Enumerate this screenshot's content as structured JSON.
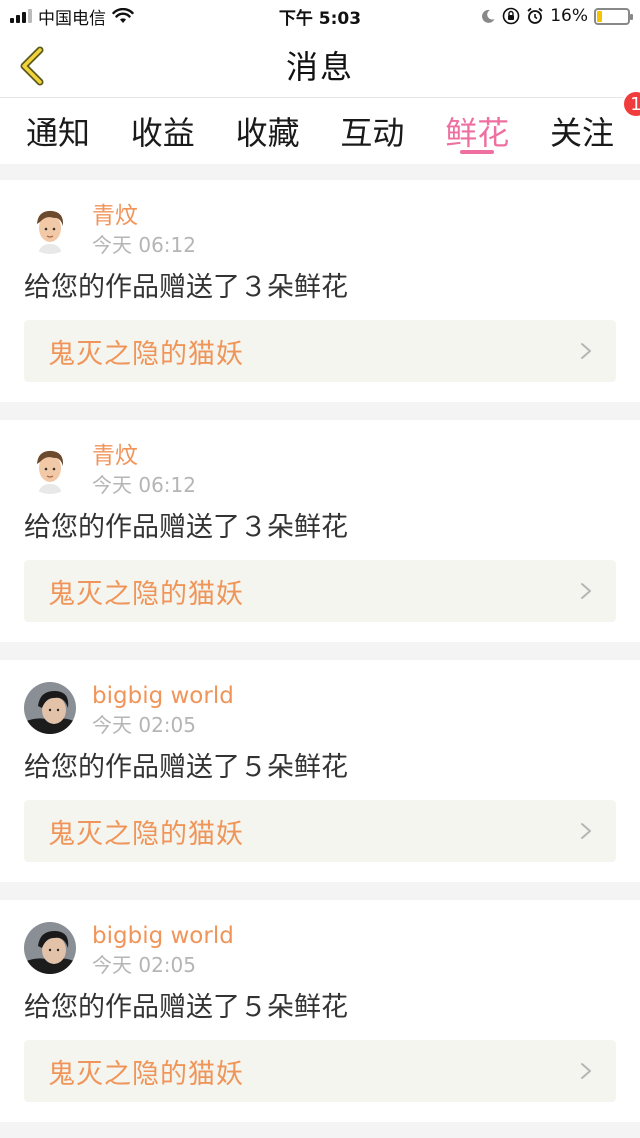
{
  "status_bar": {
    "carrier": "中国电信",
    "time": "下午 5:03",
    "battery_percent": "16%",
    "battery_level": 0.16
  },
  "nav": {
    "title": "消息"
  },
  "tabs": [
    {
      "label": "通知",
      "active": false
    },
    {
      "label": "收益",
      "active": false
    },
    {
      "label": "收藏",
      "active": false
    },
    {
      "label": "互动",
      "active": false
    },
    {
      "label": "鲜花",
      "active": true
    },
    {
      "label": "关注",
      "active": false,
      "badge": "1"
    }
  ],
  "colors": {
    "accent": "#ee6fa0",
    "username": "#f0955a",
    "badge": "#f03c3c"
  },
  "messages": [
    {
      "username": "青炆",
      "time": "今天 06:12",
      "text": "给您的作品赠送了３朵鲜花",
      "work": "鬼灭之隐的猫妖",
      "avatar": "avatar-cartoon-icon"
    },
    {
      "username": "青炆",
      "time": "今天 06:12",
      "text": "给您的作品赠送了３朵鲜花",
      "work": "鬼灭之隐的猫妖",
      "avatar": "avatar-cartoon-icon"
    },
    {
      "username": "bigbig world",
      "time": "今天 02:05",
      "text": "给您的作品赠送了５朵鲜花",
      "work": "鬼灭之隐的猫妖",
      "avatar": "avatar-photo-icon"
    },
    {
      "username": "bigbig world",
      "time": "今天 02:05",
      "text": "给您的作品赠送了５朵鲜花",
      "work": "鬼灭之隐的猫妖",
      "avatar": "avatar-photo-icon"
    }
  ]
}
